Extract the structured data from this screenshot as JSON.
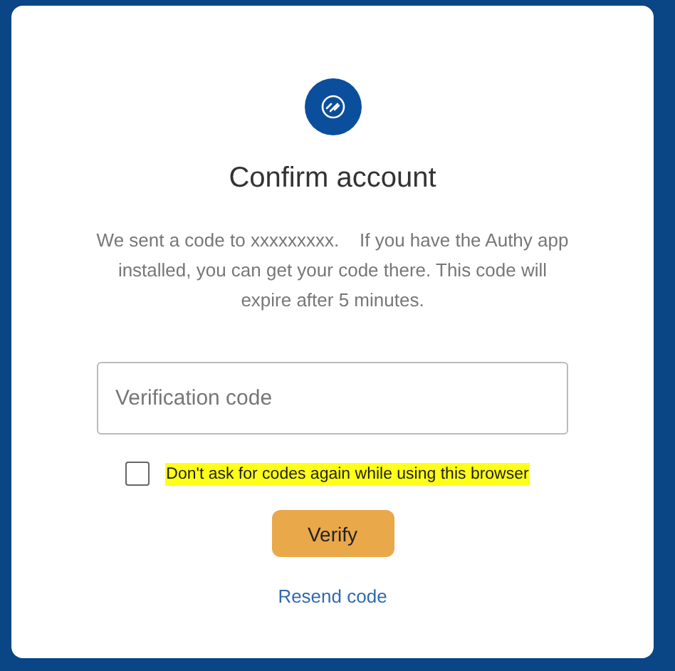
{
  "title": "Confirm account",
  "message": "We sent a code to xxxxxxxxx.    If you have the Authy app installed, you can get your code there. This code will expire after 5 minutes.",
  "code_field": {
    "placeholder": "Verification code"
  },
  "remember": {
    "label": "Don't ask for codes again while using this browser",
    "checked": false,
    "highlighted": true
  },
  "buttons": [
    {
      "label": "Verify",
      "kind": "primary"
    }
  ],
  "links": [
    {
      "label": "Resend code"
    }
  ]
}
